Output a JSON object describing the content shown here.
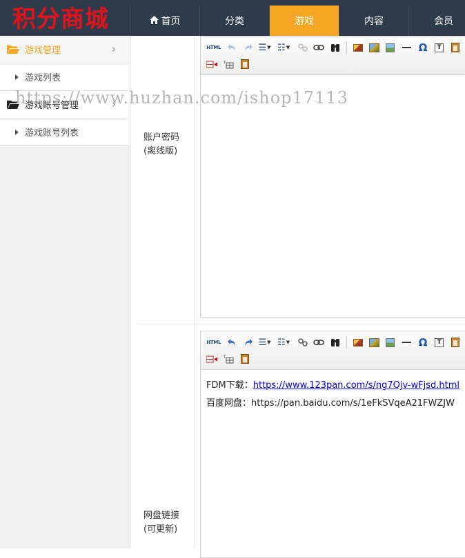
{
  "header": {
    "logo": "积分商城",
    "nav": [
      {
        "label": "首页",
        "icon": "home-icon"
      },
      {
        "label": "分类"
      },
      {
        "label": "游戏",
        "active": true
      },
      {
        "label": "内容"
      },
      {
        "label": "会员"
      }
    ],
    "accent_color": "#f5a623",
    "bg_color": "#2e3b4a"
  },
  "sidebar": {
    "groups": [
      {
        "label": "游戏管理",
        "icon": "folder-open-icon",
        "active": true,
        "items": [
          {
            "label": "游戏列表"
          }
        ]
      },
      {
        "label": "游戏账号管理",
        "icon": "folder-open-icon",
        "items": [
          {
            "label": "游戏账号列表"
          }
        ]
      }
    ]
  },
  "form": {
    "rows": [
      {
        "label_line1": "账户密码",
        "label_line2": "(离线版)"
      },
      {
        "label_line1": "网盘链接",
        "label_line2": "(可更新)"
      }
    ],
    "link_editor": {
      "line1_prefix": "FDM下载：",
      "line1_link": "https://www.123pan.com/s/ng7Qjv-wFjsd.html",
      "line2_prefix": "百度网盘：",
      "line2_text": "https://pan.baidu.com/s/1eFkSVqeA21FWZJW"
    }
  },
  "toolbar_icons": [
    "html-source-icon",
    "undo-icon",
    "redo-icon",
    "unordered-list-icon",
    "ordered-list-icon",
    "unlink-icon",
    "link-icon",
    "find-icon",
    "image-icon",
    "multi-image-icon",
    "gallery-icon",
    "horizontal-rule-icon",
    "special-char-icon",
    "paste-text-icon",
    "wordimage-icon",
    "insert-row-icon",
    "table-icon",
    "paste-icon"
  ],
  "watermark": "https://www.huzhan.com/ishop17113"
}
